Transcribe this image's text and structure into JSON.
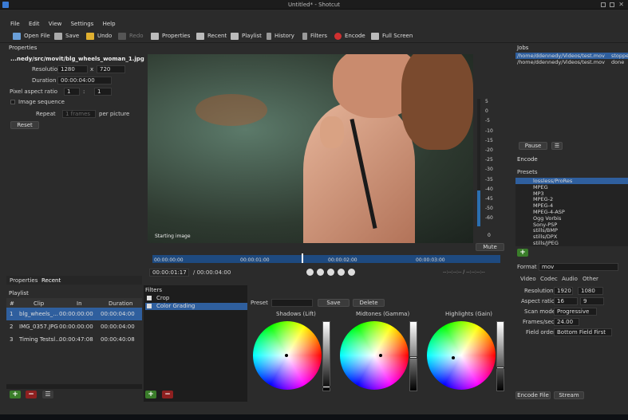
{
  "window": {
    "title": "Untitled* - Shotcut"
  },
  "menu": [
    "File",
    "Edit",
    "View",
    "Settings",
    "Help"
  ],
  "toolbar": {
    "open": "Open File",
    "save": "Save",
    "undo": "Undo",
    "redo": "Redo",
    "properties": "Properties",
    "recent": "Recent",
    "playlist": "Playlist",
    "history": "History",
    "filters": "Filters",
    "encode": "Encode",
    "fullscreen": "Full Screen"
  },
  "properties": {
    "title": "Properties",
    "filename": "...nedy/src/movit/blg_wheels_woman_1.jpg",
    "resolution_label": "Resolution",
    "res_w": "1280",
    "res_x": "x",
    "res_h": "720",
    "duration_label": "Duration",
    "duration": "00:00:04:00",
    "par_label": "Pixel aspect ratio",
    "par_a": "1",
    "par_b": "1",
    "image_seq": "Image sequence",
    "repeat_label": "Repeat",
    "repeat_val": "1 frames",
    "per_picture": "per picture",
    "reset": "Reset"
  },
  "left_tabs": [
    "Properties",
    "Recent"
  ],
  "playlist": {
    "title": "Playlist",
    "headers": [
      "#",
      "Clip",
      "In",
      "Duration"
    ],
    "rows": [
      {
        "n": "1",
        "clip": "blg_wheels_...",
        "in": "00:00:00:00",
        "dur": "00:00:04:00"
      },
      {
        "n": "2",
        "clip": "IMG_0357.JPG",
        "in": "00:00:00:00",
        "dur": "00:00:04:00"
      },
      {
        "n": "3",
        "clip": "Timing Testsl...",
        "in": "00:00:47:08",
        "dur": "00:00:40:08"
      }
    ]
  },
  "viewer": {
    "caption": "Starting image",
    "mute": "Mute",
    "meter": [
      "5",
      "0",
      "-5",
      "-10",
      "-15",
      "-20",
      "-25",
      "-30",
      "-35",
      "-40",
      "-45",
      "-50",
      "-60"
    ],
    "meter_extra": "0",
    "ticks": [
      "00:00:00:00",
      "00:00:01:00",
      "00:00:02:00",
      "00:00:03:00"
    ],
    "position": "00:00:01:17",
    "total": "/ 00:00:04:00",
    "inout": "--:--:--:-- / --:--:--:--"
  },
  "filters": {
    "title": "Filters",
    "items": [
      "Crop",
      "Color Grading"
    ],
    "preset_label": "Preset",
    "save": "Save",
    "delete": "Delete",
    "wheels": [
      "Shadows (Lift)",
      "Midtones (Gamma)",
      "Highlights (Gain)"
    ]
  },
  "jobs": {
    "title": "Jobs",
    "rows": [
      {
        "file": "/home/ddennedy/Videos/test.mov",
        "status": "stopped"
      },
      {
        "file": "/home/ddennedy/Videos/test.mov",
        "status": "done"
      }
    ],
    "pause": "Pause"
  },
  "encode": {
    "title": "Encode",
    "presets_label": "Presets",
    "presets": [
      "lossless/ProRes",
      "MPEG",
      "MP3",
      "MPEG-2",
      "MPEG-4",
      "MPEG-4-ASP",
      "Ogg Vorbis",
      "Sony-PSP",
      "stills/BMP",
      "stills/DPX",
      "stills/JPEG"
    ],
    "format_label": "Format",
    "format": "mov",
    "tabs": [
      "Video",
      "Codec",
      "Audio",
      "Other"
    ],
    "resolution_label": "Resolution",
    "res_w": "1920",
    "res_h": "1080",
    "aspect_label": "Aspect ratio",
    "aspect_a": "16",
    "aspect_b": "9",
    "scan_label": "Scan mode",
    "scan": "Progressive",
    "fps_label": "Frames/sec",
    "fps": "24.00",
    "field_label": "Field order",
    "field": "Bottom Field First",
    "encode_file": "Encode File",
    "stream": "Stream"
  }
}
